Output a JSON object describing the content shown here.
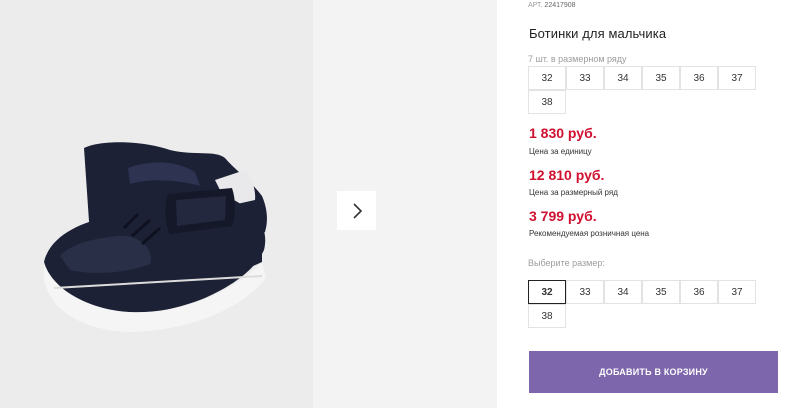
{
  "product": {
    "sku_label": "АРТ.",
    "sku_value": "22417908",
    "title": "Ботинки для мальчика",
    "size_run_note": "7 шт. в размерном ряду",
    "size_run": [
      "32",
      "33",
      "34",
      "35",
      "36",
      "37",
      "38"
    ]
  },
  "prices": [
    {
      "value": "1 830 руб.",
      "label": "Цена за единицу"
    },
    {
      "value": "12 810 руб.",
      "label": "Цена за размерный ряд"
    },
    {
      "value": "3 799 руб.",
      "label": "Рекомендуемая розничная цена"
    }
  ],
  "size_select": {
    "label": "Выберите размер:",
    "options": [
      "32",
      "33",
      "34",
      "35",
      "36",
      "37",
      "38"
    ],
    "selected": "32"
  },
  "actions": {
    "add_to_cart": "ДОБАВИТЬ В КОРЗИНУ"
  },
  "gallery": {
    "next_icon": "chevron-right-icon"
  },
  "colors": {
    "price": "#d0102f",
    "button": "#7d66ac",
    "shoe": "#1d2136"
  }
}
